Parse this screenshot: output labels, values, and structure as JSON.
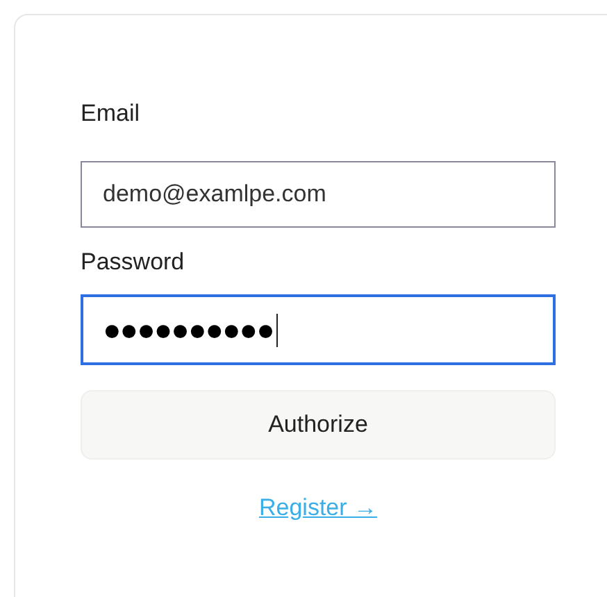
{
  "form": {
    "fields": [
      {
        "label": "Email",
        "value": "demo@examlpe.com",
        "focused": false
      },
      {
        "label": "Password",
        "value": "●●●●●●●●●●",
        "focused": true
      }
    ],
    "submit_button": "Authorize",
    "register_link": "Register →"
  }
}
